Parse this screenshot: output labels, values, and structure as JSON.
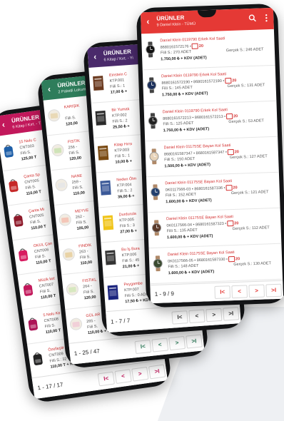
{
  "phone1": {
    "header": {
      "back": "‹",
      "title": "ÜRÜNLER",
      "subtitle": "6 Kitap / Kırt. - T"
    },
    "rows": [
      {
        "l1": "15 Nolu C",
        "l2": "CNT003",
        "l3": "Fiili S.",
        "l4": "125,00 T"
      },
      {
        "l1": "Çanta Sp",
        "l2": "CNT005",
        "l3": "Fiili S.",
        "l4": "110,00 T"
      },
      {
        "l1": "Çanta Mi",
        "l2": "CNT005",
        "l3": "Fiili S.",
        "l4": "110,00 T"
      },
      {
        "l1": "OKUL Çan",
        "l2": "CNT006",
        "l3": "Fiili S.",
        "l4": "110,00 T"
      },
      {
        "l1": "Müzik ket",
        "l2": "CNT007",
        "l3": "Fiili S.",
        "l4": "110,00 T"
      },
      {
        "l1": "5 Nolu Ke",
        "l2": "CNT008",
        "l3": "Fiili S.",
        "l4": "110,00 T"
      },
      {
        "l1": "Özelleştir",
        "l2": "CNT009",
        "l3": "Fiili S.: 32",
        "l4": "110,00 T + KDV"
      }
    ],
    "pager": {
      "text": "1 - 17 / 17",
      "first": "I<",
      "prev": "<",
      "next": ">",
      "last": ">I"
    }
  },
  "phone2": {
    "header": {
      "back": "‹",
      "title": "ÜRÜNLER",
      "subtitle": "2 Paketli Lokum"
    },
    "rows": [
      {
        "l1": "KARIŞIK",
        "l2": "",
        "l3": "Fiili S.",
        "l4": "120,00"
      },
      {
        "l1": "FISTIK",
        "l2": "256 -",
        "l3": "Fiili S.",
        "l4": "120,00"
      },
      {
        "l1": "NANE",
        "l2": "259 -",
        "l3": "Fiili S.",
        "l4": "110,00"
      },
      {
        "l1": "MEYVE",
        "l2": "262 -",
        "l3": "Fiili S.",
        "l4": "105,00"
      },
      {
        "l1": "FINDIK",
        "l2": "263 -",
        "l3": "Fiili S.",
        "l4": "110,00"
      },
      {
        "l1": "FISTIKL",
        "l2": "264 -",
        "l3": "Fiili S.",
        "l4": "120,00"
      },
      {
        "l1": "GÜL AR",
        "l2": "265 -",
        "l3": "Fiili S.",
        "l4": "110,00 ₺ + KDV"
      }
    ],
    "pager": {
      "text": "1 - 25 / 47",
      "first": "I<",
      "prev": "<",
      "next": ">",
      "last": ">I"
    }
  },
  "phone3": {
    "header": {
      "back": "‹",
      "title": "ÜRÜNLER",
      "subtitle": "6 Kitap / Kırt. - Yi"
    },
    "rows": [
      {
        "l1": "Einstein C",
        "l2": "KTP.001",
        "l3": "Fiili S.: 1",
        "l4": "17,00 ₺ +"
      },
      {
        "l1": "Bir Yumak",
        "l2": "KTP.002",
        "l3": "Fiili S.: 2",
        "l4": "25,50 ₺ +"
      },
      {
        "l1": "Kitap Hırsı",
        "l2": "KTP.003",
        "l3": "Fiili S.: 1",
        "l4": "10,00 ₺ +"
      },
      {
        "l1": "Neden Ölm",
        "l2": "KTP.004",
        "l3": "Fiili S.: 2",
        "l4": "39,00 ₺ +"
      },
      {
        "l1": "Durdurula",
        "l2": "KTP.005",
        "l3": "Fiili S.: 3",
        "l4": "27,00 ₺ +"
      },
      {
        "l1": "Bu İş Bura",
        "l2": "KTP.006",
        "l3": "Fiili S.: 45",
        "l4": "21,00 ₺ +"
      },
      {
        "l1": "Peygambe",
        "l2": "KTP.007",
        "l3": "Fiili S.: 0 ADET",
        "l4": "17,50 ₺ + KDV (ADET)"
      }
    ],
    "pager": {
      "text": "1 - 7 / 7",
      "first": "I<",
      "prev": "<",
      "next": ">",
      "last": ">I"
    }
  },
  "phone4": {
    "header": {
      "back": "‹",
      "title": "ÜRÜNLER",
      "subtitle": "9 Daniel Klein - TÜMÜ"
    },
    "rows": [
      {
        "name": "Daniel Klein 0119790 Erkek Kol Saati",
        "code": "8680161572176 •",
        "badge": "20",
        "fiili": "Fiili S.: 270 ADET",
        "gercek": "Gerçek S.: 246 ADET",
        "price": "1.750,00 ₺ + KDV (ADET)"
      },
      {
        "name": "Daniel Klein 0119790 Erkek Kol Saati",
        "code": "8680161572190 • 8680161572190 •",
        "badge": "20",
        "fiili": "Fiili S.: 145 ADET",
        "gercek": "Gerçek S.: 131 ADET",
        "price": "1.750,00 ₺ + KDV (ADET)"
      },
      {
        "name": "Daniel Klein 0119790 Erkek Kol Saati",
        "code": "8680161572213 • 8680161572213 •",
        "badge": "20",
        "fiili": "Fiili S.: 125 ADET",
        "gercek": "Gerçek S.: 53 ADET",
        "price": "1.750,00 ₺ + KDV (ADET)"
      },
      {
        "name": "Daniel Klein 01175SE Bayan Kol Saati",
        "code": "8680161587347 • 8680161587347 •",
        "badge": "20",
        "fiili": "Fiili S.: 150 ADET",
        "gercek": "Gerçek S.: 127 ADET",
        "price": "1.500,00 ₺ + KDV (ADET)"
      },
      {
        "name": "Daniel Klein 01175SE Bayan Kol Saati",
        "code": "0K0117566-03 • 8680161587336 •",
        "badge": "20",
        "fiili": "Fiili S.: 152 ADET",
        "gercek": "Gerçek S.: 121 ADET",
        "price": "1.600,00 ₺ + KDV (ADET)"
      },
      {
        "name": "Daniel Klein 01175SE Bayan Kol Saati",
        "code": "0K0117566-04 • 8680161587323 •",
        "badge": "20",
        "fiili": "Fiili S.: 135 ADET",
        "gercek": "Gerçek S.: 112 ADET",
        "price": "1.600,00 ₺ + KDV (ADET)"
      },
      {
        "name": "Daniel Klein 01175SE Bayan Kol Saati",
        "code": "0K0117566-05 • 8680161587330 •",
        "badge": "20",
        "fiili": "Fiili S.: 148 ADET",
        "gercek": "Gerçek S.: 130 ADET",
        "price": "1.600,00 ₺ + KDV (ADET)"
      }
    ],
    "pager": {
      "text": "1 - 9 / 9",
      "first": "I<",
      "prev": "<",
      "next": ">",
      "last": ">I"
    }
  },
  "colors": {
    "crimson": "#c2185b",
    "green": "#2e7d5b",
    "purple": "#4a2a6b",
    "red": "#e53935"
  }
}
